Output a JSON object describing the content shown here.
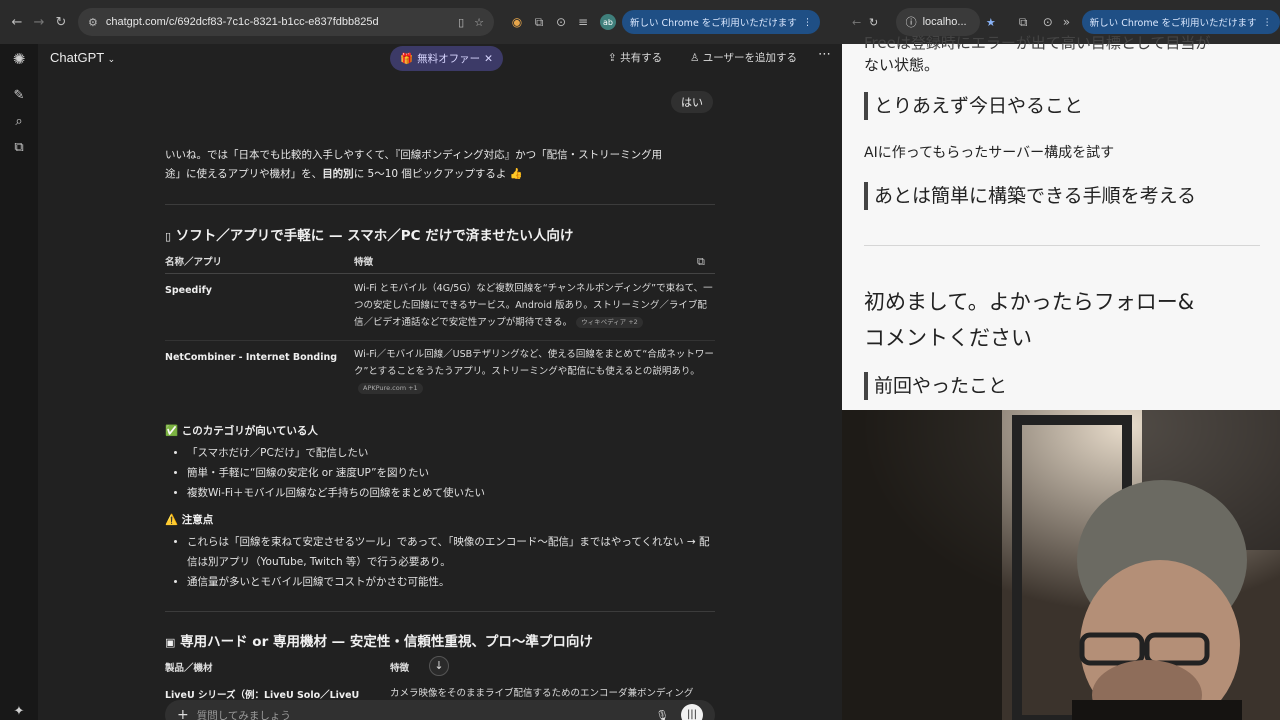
{
  "browser_left": {
    "url": "chatgpt.com/c/692dcf83-7c1c-8321-b1cc-e837fdbb825d",
    "profile": "ab",
    "update_chip": "新しい Chrome をご利用いただけます"
  },
  "chatgpt": {
    "model": "ChatGPT",
    "offer": "無料オファー",
    "share": "共有する",
    "add_user": "ユーザーを追加する",
    "user_message": "はい",
    "intro_line1": "いいね。では「日本でも比較的入手しやすくて、『回線ボンディング対応』かつ「配信・ストリーミング用",
    "intro_line2a": "途」に使えるアプリや機材」を、",
    "intro_bold": "目的別",
    "intro_line2b": "に 5〜10 個ピックアップするよ 👍",
    "section1_title": "ソフト／アプリで手軽に — スマホ／PC だけで済ませたい人向け",
    "table1": {
      "col1": "名称／アプリ",
      "col2": "特徴",
      "rows": [
        {
          "name": "Speedify",
          "desc": "Wi-Fi とモバイル（4G/5G）など複数回線を“チャンネルボンディング”で束ねて、一つの安定した回線にできるサービス。Android 版あり。ストリーミング／ライブ配信／ビデオ通話などで安定性アップが期待できる。",
          "cite": "ウィキペディア +2"
        },
        {
          "name": "NetCombiner - Internet Bonding",
          "desc": "Wi-Fi／モバイル回線／USBテザリングなど、使える回線をまとめて“合成ネットワーク”とすることをうたうアプリ。ストリーミングや配信にも使えるとの説明あり。",
          "cite": "APKPure.com +1"
        }
      ]
    },
    "fit_title": "✅ このカテゴリが向いている人",
    "fit_items": [
      "「スマホだけ／PCだけ」で配信したい",
      "簡単・手軽に“回線の安定化 or 速度UP”を図りたい",
      "複数Wi-Fi＋モバイル回線など手持ちの回線をまとめて使いたい"
    ],
    "caution_title": "⚠️ 注意点",
    "caution_items": [
      "これらは「回線を束ねて安定させるツール」であって、「映像のエンコード〜配信」まではやってくれない → 配信は別アプリ（YouTube, Twitch 等）で行う必要あり。",
      "通信量が多いとモバイル回線でコストがかさむ可能性。"
    ],
    "section2_title": "専用ハード or 専用機材 — 安定性・信頼性重視、プロ〜準プロ向け",
    "table2": {
      "col1": "製品／機材",
      "col2": "特徴",
      "row1_name": "LiveU シリーズ（例：LiveU Solo／LiveU",
      "row1_desc": "カメラ映像をそのままライブ配信するためのエンコーダ兼ボンディング"
    },
    "composer_placeholder": "質問してみましょう"
  },
  "browser_right": {
    "tab": "localho...",
    "update_chip": "新しい Chrome をご利用いただけます"
  },
  "article": {
    "top_line1": "Freeは登録時にエラーが出て高い目標として目当が",
    "top_line2": "ない状態。",
    "h_today": "とりあえず今日やること",
    "p_today": "AIに作ってもらったサーバー構成を試す",
    "h_next": "あとは簡単に構築できる手順を考える",
    "h_follow_1": "初めまして。よかったらフォロー&",
    "h_follow_2": "コメントください",
    "h_prev": "前回やったこと"
  }
}
